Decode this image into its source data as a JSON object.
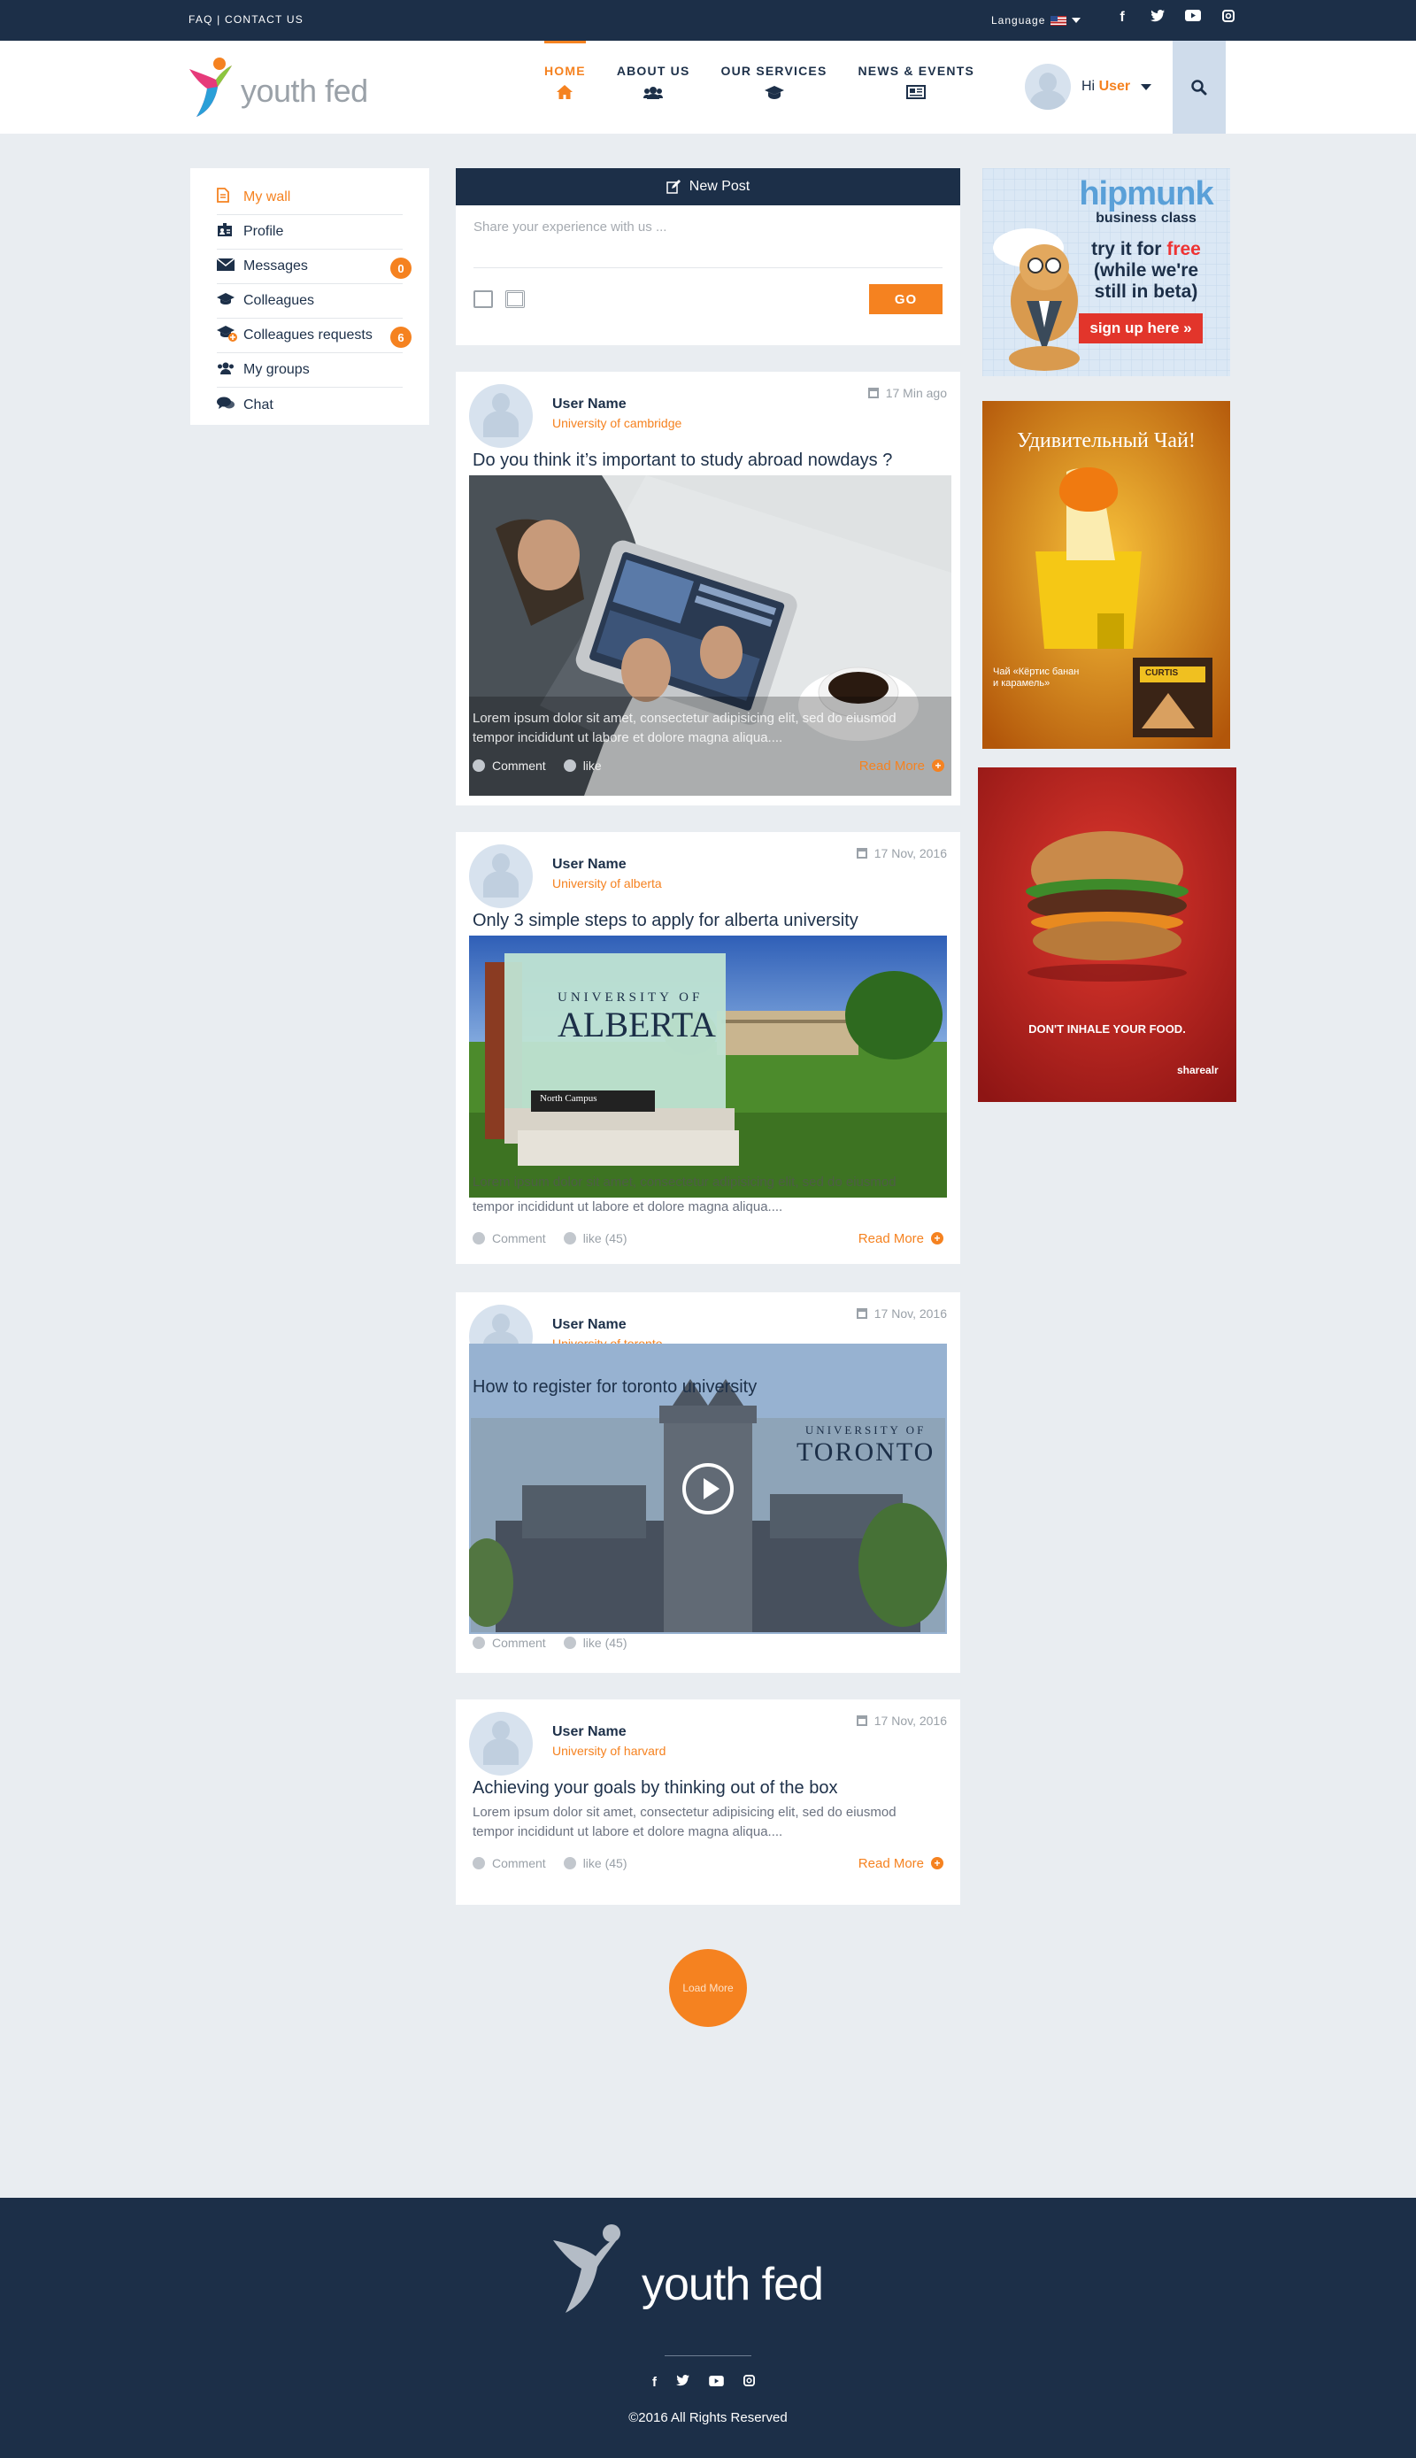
{
  "topbar": {
    "faq": "FAQ",
    "separator": "|",
    "contact": "CONTACT US",
    "language": "Language"
  },
  "brand": {
    "word_a": "youth",
    "word_b": "fed"
  },
  "nav": [
    {
      "label": "HOME",
      "icon": "home-icon",
      "glyph": "⌂"
    },
    {
      "label": "ABOUT US",
      "icon": "users-icon",
      "glyph": "👥"
    },
    {
      "label": "OUR SERVICES",
      "icon": "graduation-cap-icon",
      "glyph": "🎓"
    },
    {
      "label": "NEWS & EVENTS",
      "icon": "newspaper-icon",
      "glyph": "📰"
    }
  ],
  "user": {
    "greeting": "Hi",
    "name": "User"
  },
  "sidebar": [
    {
      "label": "My wall",
      "icon": "document-icon",
      "glyph": "🗎"
    },
    {
      "label": "Profile",
      "icon": "id-card-icon",
      "glyph": "🪪"
    },
    {
      "label": "Messages",
      "icon": "envelope-icon",
      "glyph": "✉",
      "badge": "0"
    },
    {
      "label": "Colleagues",
      "icon": "graduation-cap-icon",
      "glyph": "🎓"
    },
    {
      "label": "Colleagues requests",
      "icon": "cap-plus-icon",
      "glyph": "🎓",
      "badge": "6"
    },
    {
      "label": "My groups",
      "icon": "users-icon",
      "glyph": "👥"
    },
    {
      "label": "Chat",
      "icon": "chat-icon",
      "glyph": "💬"
    }
  ],
  "newpost": {
    "title": "New Post",
    "placeholder": "Share your experience with us ...",
    "go": "GO"
  },
  "posts": [
    {
      "user": "User Name",
      "university": "University of cambridge",
      "date": "17 Min ago",
      "title": "Do you think it’s important to study abroad nowdays ?",
      "excerpt_1": "Lorem ipsum dolor sit amet, consectetur adipisicing elit, sed do eiusmod",
      "excerpt_2": "tempor incididunt ut labore et dolore magna aliqua....",
      "comment": "Comment",
      "like": "like",
      "read_more": "Read More"
    },
    {
      "user": "User Name",
      "university": "University of alberta",
      "date": "17 Nov, 2016",
      "title": "Only 3 simple steps to apply for alberta university",
      "excerpt_1": "Lorem ipsum dolor sit amet, consectetur adipisicing elit, sed do eiusmod",
      "excerpt_2": "tempor incididunt ut labore et dolore magna aliqua....",
      "comment": "Comment",
      "like": "like (45)",
      "read_more": "Read More",
      "sign_a": "UNIVERSITY OF",
      "sign_b": "ALBERTA",
      "sign_c": "North Campus"
    },
    {
      "user": "User Name",
      "university": "University of toronto",
      "date": "17 Nov, 2016",
      "title": "How to register for toronto university",
      "comment": "Comment",
      "like": "like (45)",
      "uni_a": "UNIVERSITY OF",
      "uni_b": "TORONTO"
    },
    {
      "user": "User Name",
      "university": "University of harvard",
      "date": "17 Nov, 2016",
      "title": "Achieving your goals by thinking out of the box",
      "excerpt_1": "Lorem ipsum dolor sit amet, consectetur adipisicing elit, sed do eiusmod",
      "excerpt_2": "tempor incididunt ut labore et dolore magna aliqua....",
      "comment": "Comment",
      "like": "like (45)",
      "read_more": "Read More"
    }
  ],
  "ads": {
    "hipmunk_brand": "hipmunk",
    "hipmunk_sub": "business class",
    "hipmunk_line1": "try it for",
    "hipmunk_free": "free",
    "hipmunk_line2": "(while we're",
    "hipmunk_line3": "still in beta)",
    "hipmunk_cta": "sign up here »",
    "tea_title": "Удивительный Чай!",
    "tea_brand": "CURTIS",
    "tea_caption": "Чай «Кёртис банан и карамель»",
    "burger_tag": "DON'T INHALE YOUR FOOD.",
    "burger_brand": "sharealr"
  },
  "load_more": "Load More",
  "footer": {
    "copyright": "©2016 All Rights Reserved"
  },
  "colors": {
    "navy": "#1c2f48",
    "orange": "#f58220",
    "bg": "#e9edf1"
  }
}
